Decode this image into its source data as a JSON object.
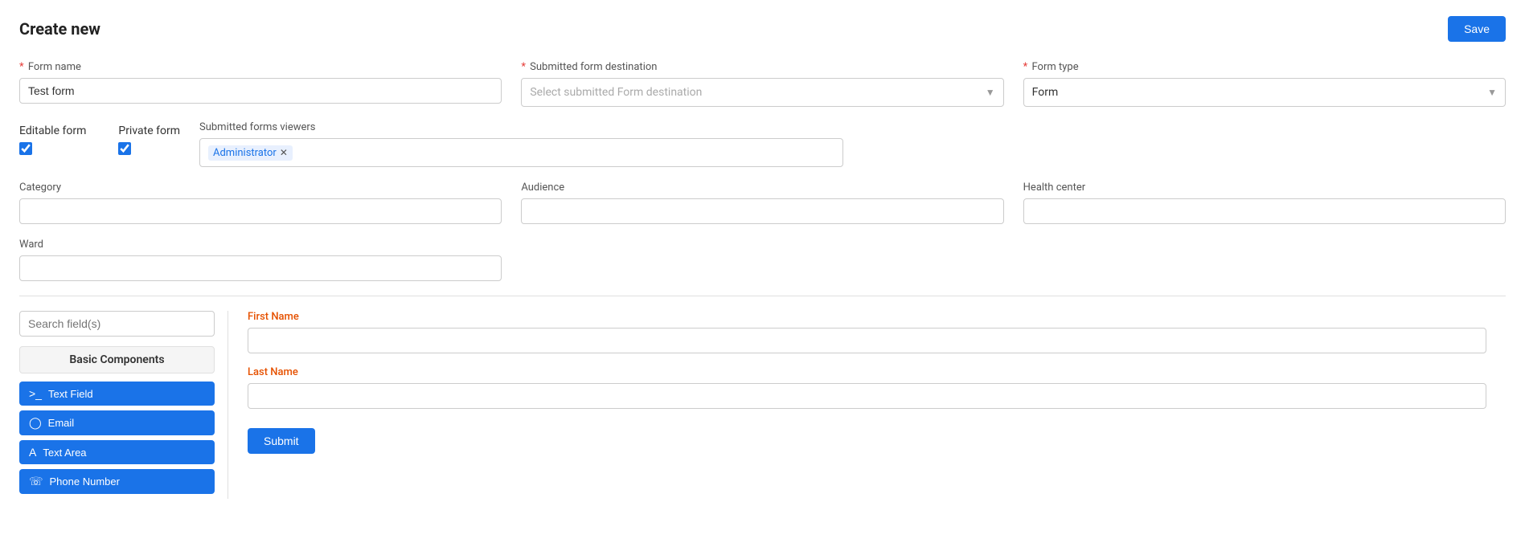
{
  "header": {
    "title": "Create new",
    "save_label": "Save"
  },
  "form": {
    "form_name": {
      "label": "Form name",
      "required": true,
      "value": "Test form",
      "placeholder": "Form name"
    },
    "submitted_form_destination": {
      "label": "Submitted form destination",
      "required": true,
      "placeholder": "Select submitted Form destination",
      "value": ""
    },
    "form_type": {
      "label": "Form type",
      "required": true,
      "value": "Form"
    },
    "editable_form": {
      "label": "Editable form",
      "checked": true
    },
    "private_form": {
      "label": "Private form",
      "checked": true
    },
    "submitted_forms_viewers": {
      "label": "Submitted forms viewers",
      "tags": [
        {
          "label": "Administrator"
        }
      ]
    },
    "category": {
      "label": "Category",
      "value": ""
    },
    "audience": {
      "label": "Audience",
      "value": ""
    },
    "health_center": {
      "label": "Health center",
      "value": ""
    },
    "ward": {
      "label": "Ward",
      "value": ""
    }
  },
  "sidebar": {
    "search_placeholder": "Search field(s)",
    "section_title": "Basic Components",
    "components": [
      {
        "icon": ">_",
        "label": "Text Field"
      },
      {
        "icon": "@",
        "label": "Email"
      },
      {
        "icon": "A",
        "label": "Text Area"
      },
      {
        "icon": "☎",
        "label": "Phone Number"
      }
    ]
  },
  "canvas": {
    "fields": [
      {
        "label": "First Name",
        "required": false,
        "type": "text"
      },
      {
        "label": "Last Name",
        "required": false,
        "type": "text"
      }
    ],
    "submit_label": "Submit"
  }
}
